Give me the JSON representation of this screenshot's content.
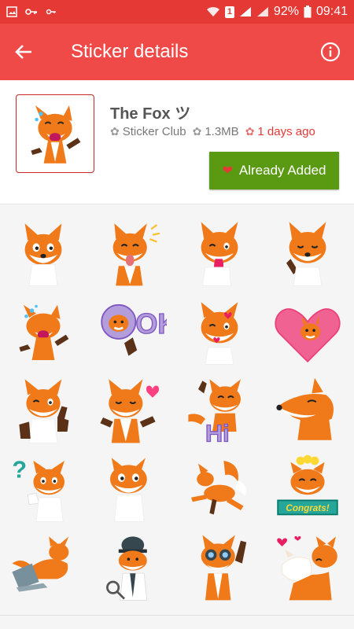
{
  "status_bar": {
    "battery": "92%",
    "time": "09:41",
    "sim_label": "1",
    "icons": [
      "image-icon",
      "key-icon",
      "key-small-icon",
      "wifi-icon",
      "signal-icon",
      "signal-icon-2",
      "battery-icon"
    ]
  },
  "app_bar": {
    "title": "Sticker details",
    "back_icon": "arrow-left-icon",
    "info_icon": "info-icon",
    "color": "#ef4a48"
  },
  "pack": {
    "name": "The Fox ツ",
    "publisher": "Sticker Club",
    "size": "1.3MB",
    "updated": "1 days ago",
    "button_label": "Already Added",
    "button_color": "#5a9a13"
  },
  "stickers": [
    {
      "name": "fox-smirk"
    },
    {
      "name": "fox-tongue-out"
    },
    {
      "name": "fox-lick"
    },
    {
      "name": "fox-thinking"
    },
    {
      "name": "fox-laughing"
    },
    {
      "name": "fox-ok"
    },
    {
      "name": "fox-kisses"
    },
    {
      "name": "fox-heart-balloon"
    },
    {
      "name": "fox-wink-thumb"
    },
    {
      "name": "fox-shrug-heart"
    },
    {
      "name": "fox-hi"
    },
    {
      "name": "fox-sly"
    },
    {
      "name": "fox-question"
    },
    {
      "name": "fox-curious"
    },
    {
      "name": "fox-running"
    },
    {
      "name": "fox-congrats"
    },
    {
      "name": "fox-laptop"
    },
    {
      "name": "fox-detective"
    },
    {
      "name": "fox-binoculars"
    },
    {
      "name": "fox-hug-hearts"
    }
  ],
  "sticker_texts": {
    "ok": "OK",
    "hi": "Hi",
    "congrats": "Congrats!",
    "question": "?"
  }
}
